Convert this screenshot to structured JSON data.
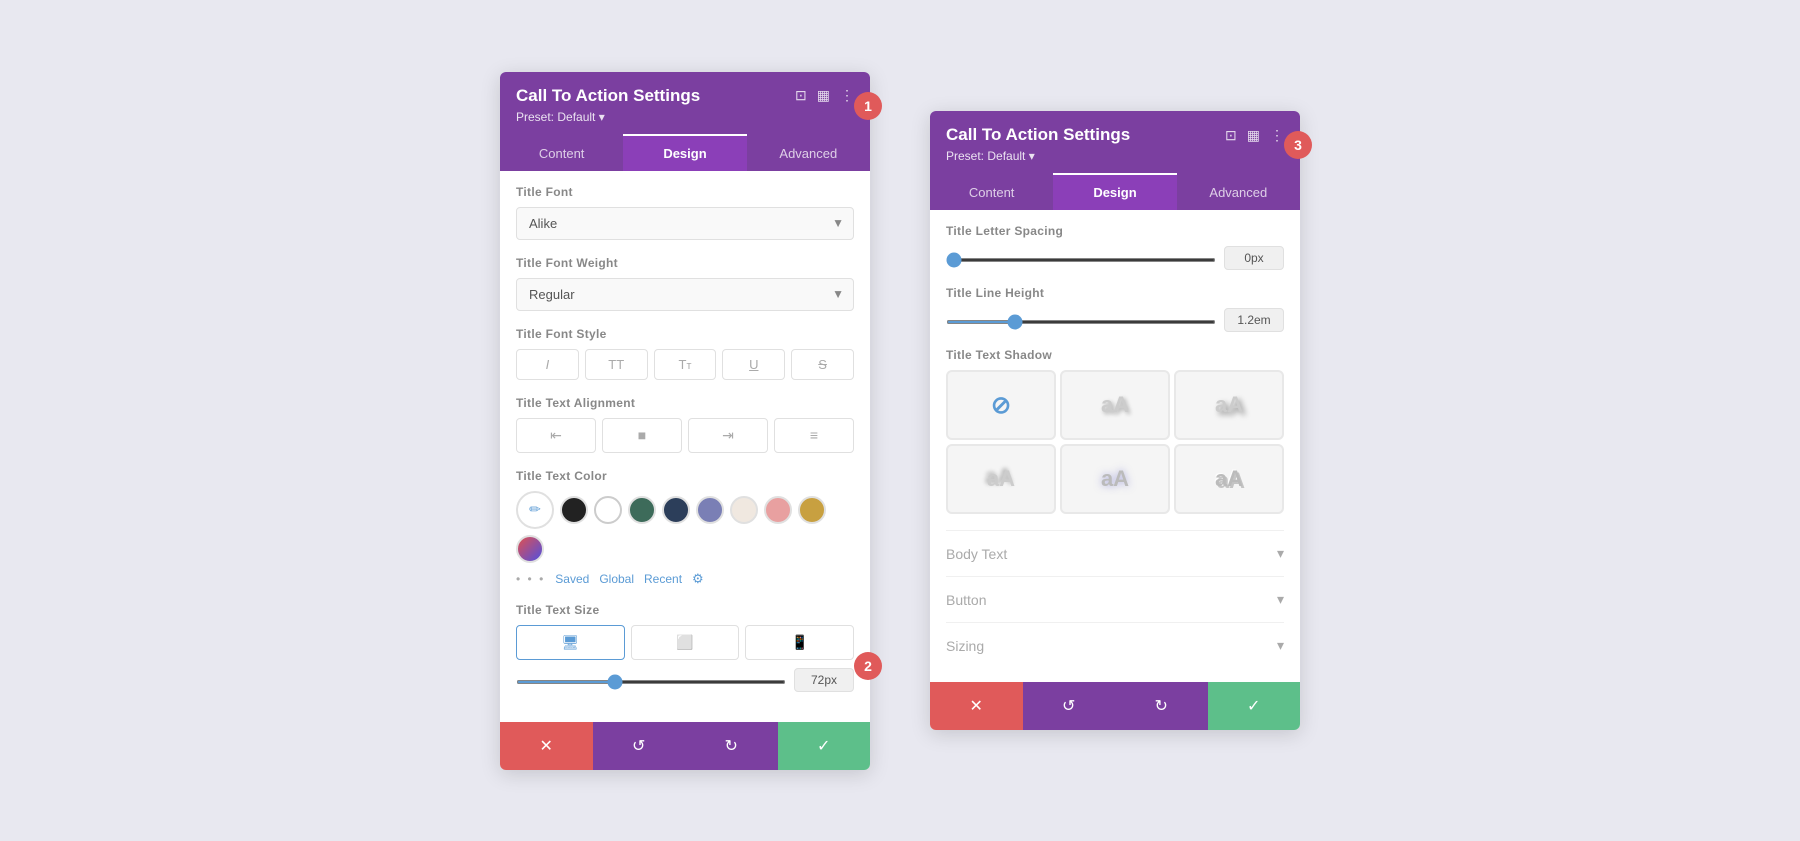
{
  "panel1": {
    "title": "Call To Action Settings",
    "preset": "Preset: Default ▾",
    "tabs": [
      "Content",
      "Design",
      "Advanced"
    ],
    "active_tab": "Design",
    "badge": "1",
    "sections": {
      "title_font": {
        "label": "Title Font",
        "value": "Alike"
      },
      "title_font_weight": {
        "label": "Title Font Weight",
        "value": "Regular"
      },
      "title_font_style": {
        "label": "Title Font Style",
        "buttons": [
          "I",
          "TT",
          "Tт",
          "U",
          "S"
        ]
      },
      "title_text_alignment": {
        "label": "Title Text Alignment",
        "buttons": [
          "≡",
          "≡",
          "≡",
          "≡"
        ]
      },
      "title_text_color": {
        "label": "Title Text Color",
        "colors": [
          "#222222",
          "#ffffff",
          "#3d6b5a",
          "#2c3e5a",
          "#7a7fb5",
          "#f0e8e0",
          "#e8a0a0",
          "#c8a040",
          "#e05050"
        ]
      },
      "title_text_size": {
        "label": "Title Text Size",
        "value": "72px",
        "badge": "2"
      }
    },
    "footer": {
      "cancel": "✕",
      "undo": "↺",
      "redo": "↻",
      "save": "✓"
    }
  },
  "panel2": {
    "title": "Call To Action Settings",
    "preset": "Preset: Default ▾",
    "tabs": [
      "Content",
      "Design",
      "Advanced"
    ],
    "active_tab": "Design",
    "badge": "3",
    "sections": {
      "title_letter_spacing": {
        "label": "Title Letter Spacing",
        "value": "0px"
      },
      "title_line_height": {
        "label": "Title Line Height",
        "value": "1.2em"
      },
      "title_text_shadow": {
        "label": "Title Text Shadow"
      },
      "body_text": {
        "label": "Body Text"
      },
      "button": {
        "label": "Button"
      },
      "sizing": {
        "label": "Sizing"
      }
    },
    "footer": {
      "cancel": "✕",
      "undo": "↺",
      "redo": "↻",
      "save": "✓"
    }
  }
}
